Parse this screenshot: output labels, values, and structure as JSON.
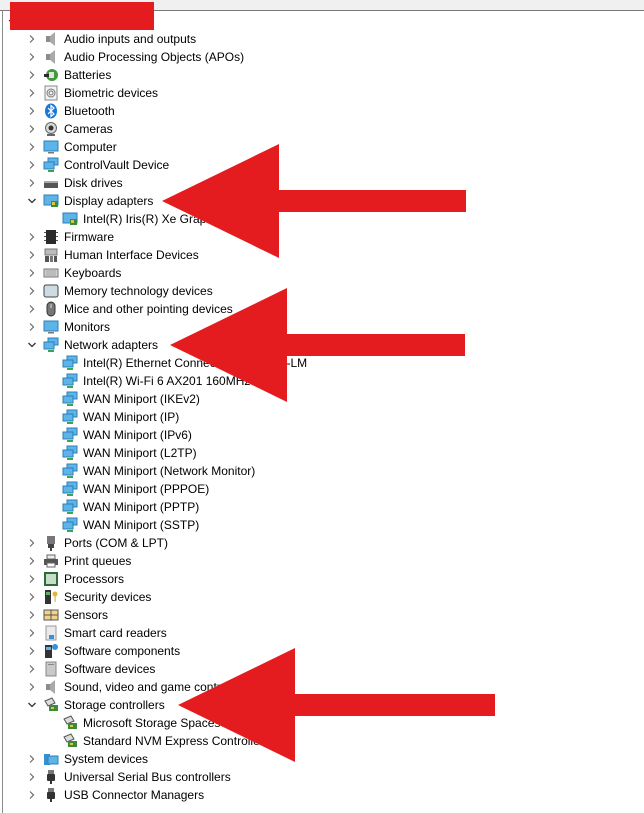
{
  "window": {
    "title_redacted": true,
    "redaction_color": "#e41c1f"
  },
  "tree": [
    {
      "label": "Audio inputs and outputs",
      "icon": "speaker-icon",
      "expanded": false,
      "children": []
    },
    {
      "label": "Audio Processing Objects (APOs)",
      "icon": "speaker-icon",
      "expanded": false,
      "children": []
    },
    {
      "label": "Batteries",
      "icon": "battery-icon",
      "expanded": false,
      "children": []
    },
    {
      "label": "Biometric devices",
      "icon": "fingerprint-icon",
      "expanded": false,
      "children": []
    },
    {
      "label": "Bluetooth",
      "icon": "bluetooth-icon",
      "expanded": false,
      "children": []
    },
    {
      "label": "Cameras",
      "icon": "webcam-icon",
      "expanded": false,
      "children": []
    },
    {
      "label": "Computer",
      "icon": "monitor-icon",
      "expanded": false,
      "children": []
    },
    {
      "label": "ControlVault Device",
      "icon": "network-icon",
      "expanded": false,
      "children": []
    },
    {
      "label": "Disk drives",
      "icon": "disk-drive-icon",
      "expanded": false,
      "children": []
    },
    {
      "label": "Display adapters",
      "icon": "display-adapter-icon",
      "expanded": true,
      "children": [
        {
          "label": "Intel(R) Iris(R) Xe Graphics",
          "icon": "display-adapter-icon"
        }
      ]
    },
    {
      "label": "Firmware",
      "icon": "chip-icon",
      "expanded": false,
      "children": []
    },
    {
      "label": "Human Interface Devices",
      "icon": "hid-icon",
      "expanded": false,
      "children": []
    },
    {
      "label": "Keyboards",
      "icon": "keyboard-icon",
      "expanded": false,
      "children": []
    },
    {
      "label": "Memory technology devices",
      "icon": "memory-device-icon",
      "expanded": false,
      "children": []
    },
    {
      "label": "Mice and other pointing devices",
      "icon": "mouse-icon",
      "expanded": false,
      "children": []
    },
    {
      "label": "Monitors",
      "icon": "monitor-icon",
      "expanded": false,
      "children": []
    },
    {
      "label": "Network adapters",
      "icon": "network-icon",
      "expanded": true,
      "children": [
        {
          "label": "Intel(R) Ethernet Connection (13) I219-LM",
          "icon": "network-icon"
        },
        {
          "label": "Intel(R) Wi-Fi 6 AX201 160MHz",
          "icon": "network-icon"
        },
        {
          "label": "WAN Miniport (IKEv2)",
          "icon": "network-icon"
        },
        {
          "label": "WAN Miniport (IP)",
          "icon": "network-icon"
        },
        {
          "label": "WAN Miniport (IPv6)",
          "icon": "network-icon"
        },
        {
          "label": "WAN Miniport (L2TP)",
          "icon": "network-icon"
        },
        {
          "label": "WAN Miniport (Network Monitor)",
          "icon": "network-icon"
        },
        {
          "label": "WAN Miniport (PPPOE)",
          "icon": "network-icon"
        },
        {
          "label": "WAN Miniport (PPTP)",
          "icon": "network-icon"
        },
        {
          "label": "WAN Miniport (SSTP)",
          "icon": "network-icon"
        }
      ]
    },
    {
      "label": "Ports (COM & LPT)",
      "icon": "port-icon",
      "expanded": false,
      "children": []
    },
    {
      "label": "Print queues",
      "icon": "printer-icon",
      "expanded": false,
      "children": []
    },
    {
      "label": "Processors",
      "icon": "processor-icon",
      "expanded": false,
      "children": []
    },
    {
      "label": "Security devices",
      "icon": "security-key-icon",
      "expanded": false,
      "children": []
    },
    {
      "label": "Sensors",
      "icon": "sensor-icon",
      "expanded": false,
      "children": []
    },
    {
      "label": "Smart card readers",
      "icon": "smart-card-icon",
      "expanded": false,
      "children": []
    },
    {
      "label": "Software components",
      "icon": "software-component-icon",
      "expanded": false,
      "children": []
    },
    {
      "label": "Software devices",
      "icon": "software-device-icon",
      "expanded": false,
      "children": []
    },
    {
      "label": "Sound, video and game controllers",
      "icon": "speaker-icon",
      "expanded": false,
      "children": []
    },
    {
      "label": "Storage controllers",
      "icon": "storage-controller-icon",
      "expanded": true,
      "children": [
        {
          "label": "Microsoft Storage Spaces Controller",
          "icon": "storage-controller-icon"
        },
        {
          "label": "Standard NVM Express Controller",
          "icon": "storage-controller-icon"
        }
      ]
    },
    {
      "label": "System devices",
      "icon": "system-folder-icon",
      "expanded": false,
      "children": []
    },
    {
      "label": "Universal Serial Bus controllers",
      "icon": "usb-icon",
      "expanded": false,
      "children": []
    },
    {
      "label": "USB Connector Managers",
      "icon": "usb-icon",
      "expanded": false,
      "children": []
    }
  ],
  "annotations": [
    {
      "type": "arrow",
      "points_to": "Display adapters",
      "color": "#e41c1f"
    },
    {
      "type": "arrow",
      "points_to": "Network adapters",
      "color": "#e41c1f"
    },
    {
      "type": "arrow",
      "points_to": "Storage controllers",
      "color": "#e41c1f"
    }
  ]
}
